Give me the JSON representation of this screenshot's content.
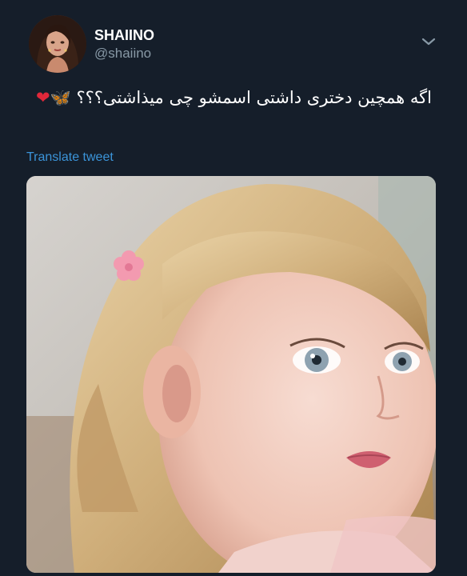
{
  "author": {
    "display_name": "SHAIINO",
    "handle": "@shaiino"
  },
  "tweet": {
    "text": "اگه همچین دختری داشتی اسمشو چی میذاشتی؟؟؟",
    "emoji_butterfly": "🦋",
    "emoji_heart": "❤"
  },
  "actions": {
    "translate_label": "Translate tweet"
  },
  "colors": {
    "background": "#151e2a",
    "link": "#3b94d9",
    "secondary_text": "#8899a6"
  },
  "icons": {
    "menu": "chevron-down-icon"
  }
}
